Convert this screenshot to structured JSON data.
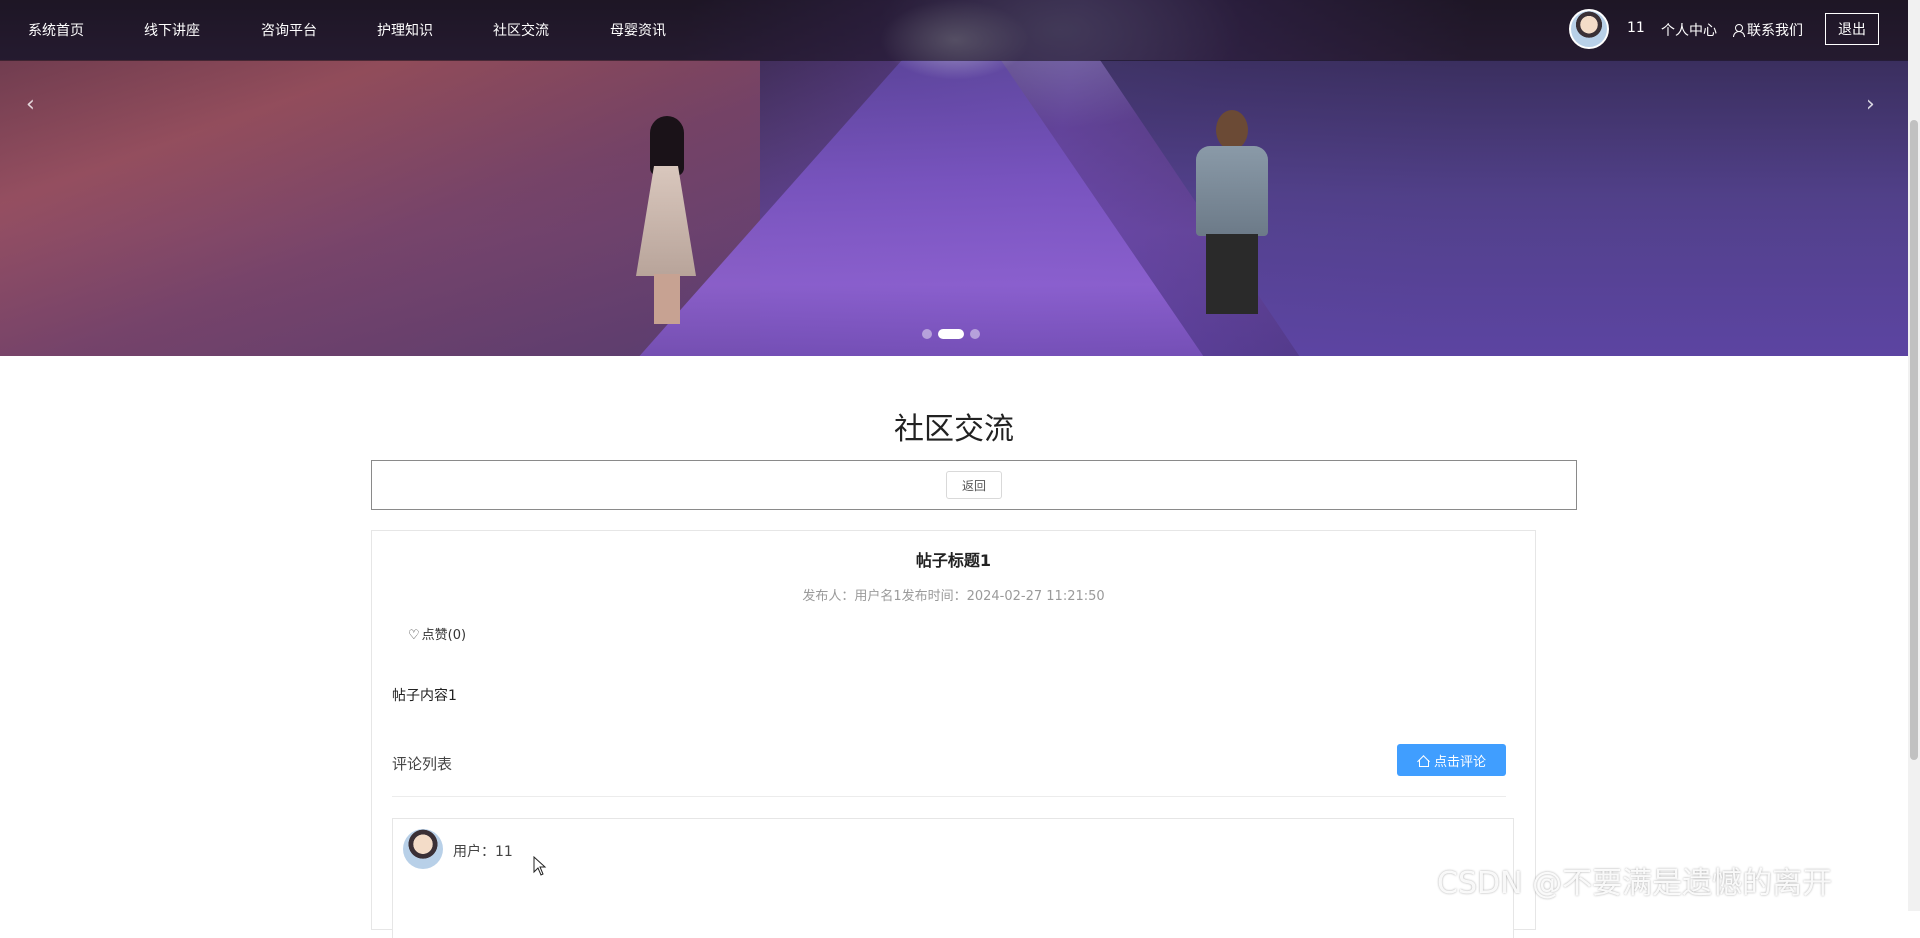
{
  "navbar": {
    "items": [
      {
        "label": "系统首页"
      },
      {
        "label": "线下讲座"
      },
      {
        "label": "咨询平台"
      },
      {
        "label": "护理知识"
      },
      {
        "label": "社区交流"
      },
      {
        "label": "母婴资讯"
      }
    ],
    "username": "11",
    "profile_label": "个人中心",
    "contact_label": "联系我们",
    "logout_label": "退出"
  },
  "carousel": {
    "prev_icon": "chevron-left-icon",
    "next_icon": "chevron-right-icon",
    "slide_count": 3,
    "active_index": 1
  },
  "page": {
    "title": "社区交流",
    "back_label": "返回"
  },
  "post": {
    "title": "帖子标题1",
    "meta": "发布人：用户名1发布时间：2024-02-27 11:21:50",
    "like_label": "点赞(0)",
    "content": "帖子内容1",
    "comments_label": "评论列表",
    "comment_button_label": "点击评论"
  },
  "comments": [
    {
      "user": "用户：11"
    }
  ],
  "watermark": "CSDN @不要满是遗憾的离开",
  "colors": {
    "primary": "#409eff",
    "nav_text": "#ffffff"
  }
}
